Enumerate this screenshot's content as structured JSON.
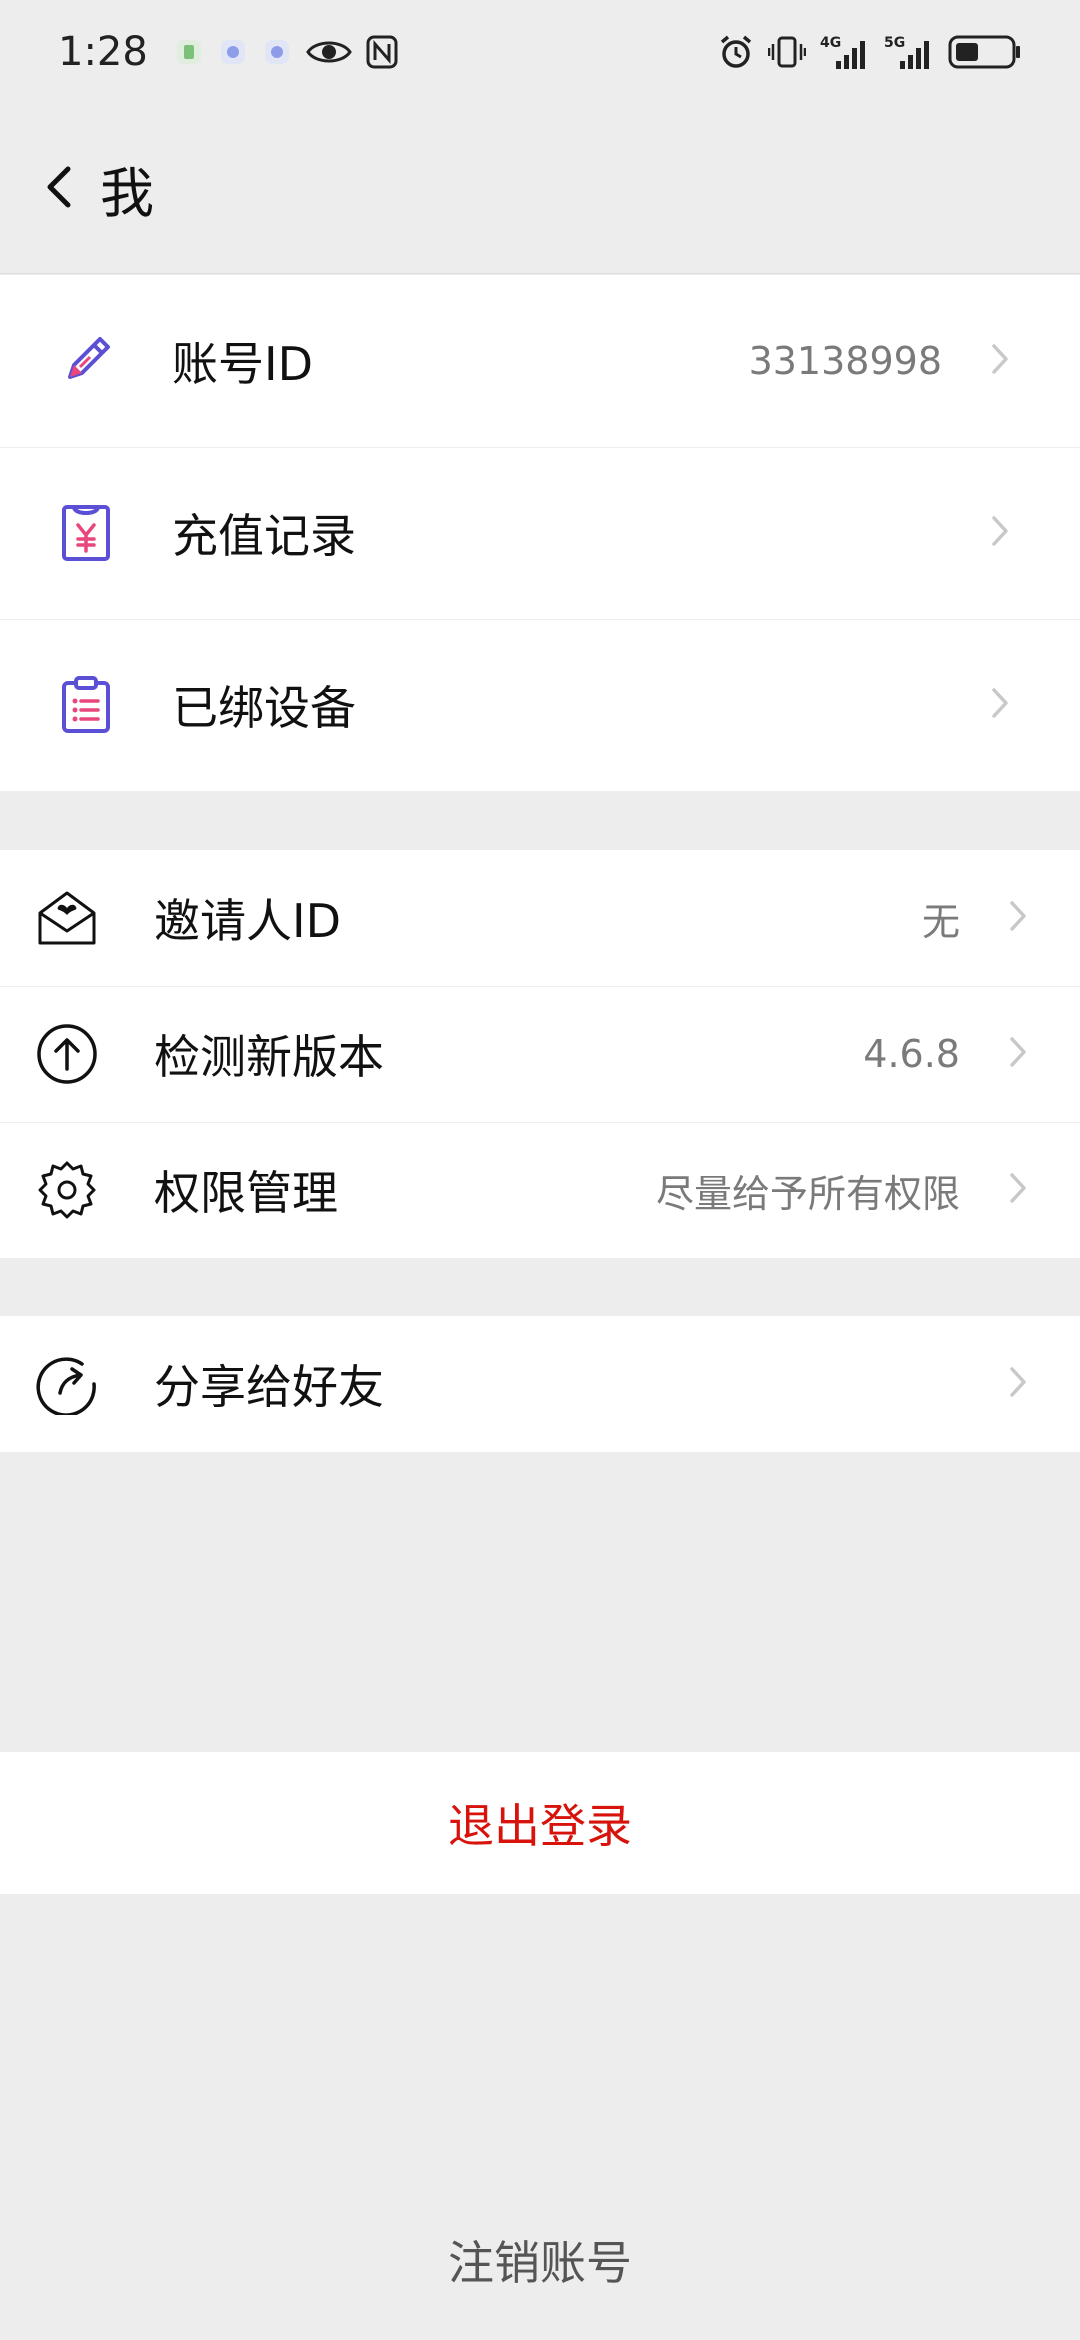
{
  "status_bar": {
    "time": "1:28",
    "network_4g": "4G",
    "network_5g": "5G"
  },
  "header": {
    "title": "我"
  },
  "sections": {
    "account": [
      {
        "label": "账号ID",
        "value": "33138998",
        "icon": "pencil-icon"
      },
      {
        "label": "充值记录",
        "value": "",
        "icon": "receipt-yuan-icon"
      },
      {
        "label": "已绑设备",
        "value": "",
        "icon": "clipboard-icon"
      }
    ],
    "settings": [
      {
        "label": "邀请人ID",
        "value": "无",
        "icon": "envelope-heart-icon"
      },
      {
        "label": "检测新版本",
        "value": "4.6.8",
        "icon": "upload-circle-icon"
      },
      {
        "label": "权限管理",
        "value": "尽量给予所有权限",
        "icon": "gear-icon"
      }
    ],
    "share": [
      {
        "label": "分享给好友",
        "value": "",
        "icon": "share-refresh-icon"
      }
    ]
  },
  "actions": {
    "logout": "退出登录",
    "deregister": "注销账号"
  },
  "colors": {
    "background": "#ededed",
    "accent_purple": "#5b4fd6",
    "accent_pink": "#e8467c",
    "danger": "#d7130c"
  }
}
